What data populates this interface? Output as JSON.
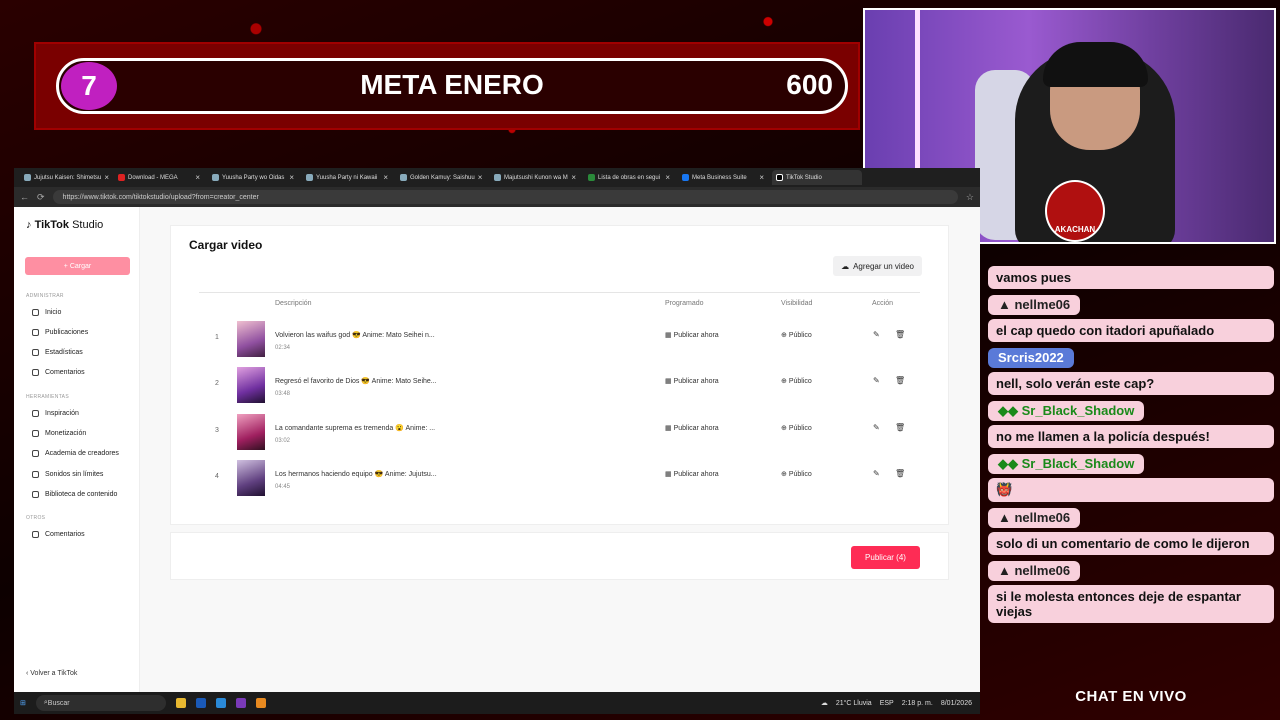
{
  "goal": {
    "number": "7",
    "title": "META ENERO",
    "value": "600"
  },
  "cam": {
    "badge": "AKACHAN"
  },
  "browser": {
    "tabs": [
      "Jujutsu Kaisen: Shimetsu",
      "Download - MEGA",
      "Yuusha Party wo Oidas",
      "Yuusha Party ni Kawaii",
      "Golden Kamuy: Saishuu",
      "Majutsushi Kunon wa M",
      "Lista de obras en segui",
      "Meta Business Suite",
      "TikTok Studio"
    ],
    "url": "https://www.tiktok.com/tiktokstudio/upload?from=creator_center"
  },
  "sidebar": {
    "logo": "TikTok",
    "logo_suffix": "Studio",
    "upload": "+ Cargar",
    "section_admin": "ADMINISTRAR",
    "admin_items": [
      "Inicio",
      "Publicaciones",
      "Estadísticas",
      "Comentarios"
    ],
    "section_tools": "HERRAMIENTAS",
    "tool_items": [
      "Inspiración",
      "Monetización",
      "Academia de creadores",
      "Sonidos sin límites",
      "Biblioteca de contenido"
    ],
    "section_other": "OTROS",
    "other_items": [
      "Comentarios"
    ],
    "back": "‹ Volver a TikTok"
  },
  "main": {
    "title": "Cargar video",
    "add_video": "Agregar un video",
    "headers": {
      "desc": "Descripción",
      "prog": "Programado",
      "vis": "Visibilidad",
      "action": "Acción"
    },
    "rows": [
      {
        "n": "1",
        "desc": "Volvieron las waifus god 😎 Anime: Mato Seihei n...",
        "dur": "02:34",
        "prog": "Publicar ahora",
        "vis": "Público"
      },
      {
        "n": "2",
        "desc": "Regresó el favorito de Dios 😎 Anime: Mato Seihe...",
        "dur": "03:48",
        "prog": "Publicar ahora",
        "vis": "Público"
      },
      {
        "n": "3",
        "desc": "La comandante suprema es tremenda 😮 Anime: ...",
        "dur": "03:02",
        "prog": "Publicar ahora",
        "vis": "Público"
      },
      {
        "n": "4",
        "desc": "Los hermanos haciendo equipo 😎 Anime: Jujutsu...",
        "dur": "04:45",
        "prog": "Publicar ahora",
        "vis": "Público"
      }
    ],
    "publish": "Publicar (4)"
  },
  "taskbar": {
    "search": "Buscar",
    "weather": "21°C Lluvia",
    "lang": "ESP",
    "time": "2:18 p. m.",
    "date": "8/01/2026"
  },
  "chat": {
    "label": "CHAT EN VIVO",
    "messages": [
      {
        "name": "",
        "text": "vamos pues"
      },
      {
        "name": "nellme06",
        "text": "el cap quedo con itadori apuñalado"
      },
      {
        "name": "Srcris2022",
        "text": "nell, solo verán este cap?"
      },
      {
        "name": "Sr_Black_Shadow",
        "text": "no me llamen a la policía después!"
      },
      {
        "name": "Sr_Black_Shadow",
        "text": "👹"
      },
      {
        "name": "nellme06",
        "text": "solo di un comentario de como le dijeron"
      },
      {
        "name": "nellme06",
        "text": "si le molesta entonces deje de espantar viejas"
      }
    ]
  },
  "colors": {
    "accent": "#fe2c55",
    "upload": "#fe8fa2",
    "goal_bg": "#7a0000"
  }
}
